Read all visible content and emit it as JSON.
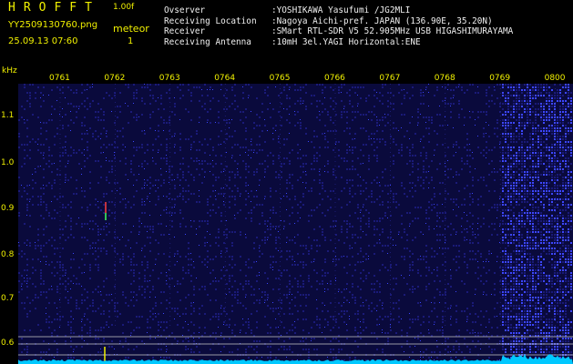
{
  "header": {
    "app_title": "HROFFT",
    "version": "1.00f",
    "file_name": "YY2509130760.png",
    "timestamp": "25.09.13 07:60",
    "counter_label": "meteor",
    "counter_value": "1"
  },
  "station": {
    "rows": [
      {
        "label": "Ovserver",
        "value": ":YOSHIKAWA Yasufumi /JG2MLI"
      },
      {
        "label": "Receiving Location",
        "value": ":Nagoya Aichi-pref. JAPAN (136.90E, 35.20N)"
      },
      {
        "label": "Receiver",
        "value": ":SMart RTL-SDR V5 52.905MHz USB HIGASHIMURAYAMA"
      },
      {
        "label": "Receiving Antenna",
        "value": ":10mH 3el.YAGI Horizontal:ENE"
      }
    ]
  },
  "chart_data": {
    "type": "heatmap",
    "y_unit": "kHz",
    "y_ticks": [
      "1.1",
      "1.0",
      "0.9",
      "0.8",
      "0.7",
      "0.6"
    ],
    "x_ticks": [
      "0761",
      "0762",
      "0763",
      "0764",
      "0765",
      "0766",
      "0767",
      "0768",
      "0769",
      "0800"
    ],
    "colors": {
      "background": "#0a0a3c",
      "noise_low": "#1a1a78",
      "noise_high": "#3c46ff",
      "accent": "#f0f000",
      "baseline": "#00c8ff"
    }
  }
}
